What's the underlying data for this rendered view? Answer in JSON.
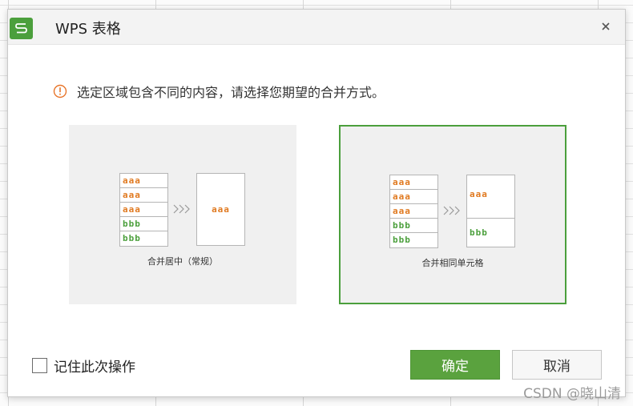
{
  "window": {
    "title": "WPS 表格"
  },
  "message": "选定区域包含不同的内容，请选择您期望的合并方式。",
  "options": [
    {
      "caption": "合并居中（常规）",
      "source_cells": [
        "aaa",
        "aaa",
        "aaa",
        "bbb",
        "bbb"
      ],
      "result_cells": [
        "aaa"
      ],
      "selected": false
    },
    {
      "caption": "合并相同单元格",
      "source_cells": [
        "aaa",
        "aaa",
        "aaa",
        "bbb",
        "bbb"
      ],
      "result_cells": [
        "aaa",
        "bbb"
      ],
      "selected": true
    }
  ],
  "remember": {
    "label": "记住此次操作",
    "checked": false
  },
  "buttons": {
    "ok": "确定",
    "cancel": "取消"
  },
  "watermark": "CSDN @晓山清",
  "colors": {
    "accent": "#4b9f3c",
    "orange": "#e0791f",
    "ok_button": "#5aa23e"
  },
  "icons": {
    "app": "wps-spreadsheet-logo",
    "warning": "warning-circle-icon",
    "close": "close-icon",
    "arrows": "triple-chevron-right-icon"
  }
}
